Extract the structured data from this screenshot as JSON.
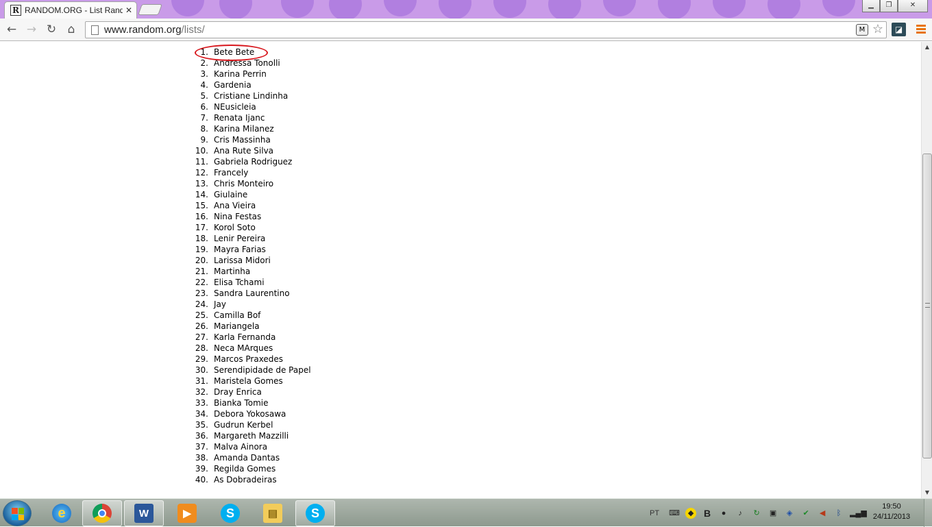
{
  "browser": {
    "tab_title": "RANDOM.ORG - List Rand",
    "tab_favicon_letter": "R",
    "url_host": "www.random.org",
    "url_path": "/lists/"
  },
  "list": [
    {
      "n": "1.",
      "name": "Bete Bete"
    },
    {
      "n": "2.",
      "name": "Andressa Tonolli"
    },
    {
      "n": "3.",
      "name": "Karina Perrin"
    },
    {
      "n": "4.",
      "name": "Gardenia"
    },
    {
      "n": "5.",
      "name": "Cristiane Lindinha"
    },
    {
      "n": "6.",
      "name": "NEusicleia"
    },
    {
      "n": "7.",
      "name": "Renata Ijanc"
    },
    {
      "n": "8.",
      "name": "Karina Milanez"
    },
    {
      "n": "9.",
      "name": "Cris Massinha"
    },
    {
      "n": "10.",
      "name": "Ana Rute Silva"
    },
    {
      "n": "11.",
      "name": "Gabriela Rodriguez"
    },
    {
      "n": "12.",
      "name": "Francely"
    },
    {
      "n": "13.",
      "name": "Chris Monteiro"
    },
    {
      "n": "14.",
      "name": "Giulaine"
    },
    {
      "n": "15.",
      "name": "Ana Vieira"
    },
    {
      "n": "16.",
      "name": "Nina Festas"
    },
    {
      "n": "17.",
      "name": "Korol Soto"
    },
    {
      "n": "18.",
      "name": "Lenir Pereira"
    },
    {
      "n": "19.",
      "name": "Mayra Farias"
    },
    {
      "n": "20.",
      "name": "Larissa Midori"
    },
    {
      "n": "21.",
      "name": "Martinha"
    },
    {
      "n": "22.",
      "name": "Elisa Tchami"
    },
    {
      "n": "23.",
      "name": "Sandra Laurentino"
    },
    {
      "n": "24.",
      "name": "Jay"
    },
    {
      "n": "25.",
      "name": "Camilla Bof"
    },
    {
      "n": "26.",
      "name": "Mariangela"
    },
    {
      "n": "27.",
      "name": "Karla Fernanda"
    },
    {
      "n": "28.",
      "name": "Neca MArques"
    },
    {
      "n": "29.",
      "name": "Marcos Praxedes"
    },
    {
      "n": "30.",
      "name": "Serendipidade de Papel"
    },
    {
      "n": "31.",
      "name": "Maristela Gomes"
    },
    {
      "n": "32.",
      "name": "Dray Enrica"
    },
    {
      "n": "33.",
      "name": "Bianka Tomie"
    },
    {
      "n": "34.",
      "name": "Debora Yokosawa"
    },
    {
      "n": "35.",
      "name": "Gudrun Kerbel"
    },
    {
      "n": "36.",
      "name": "Margareth Mazzilli"
    },
    {
      "n": "37.",
      "name": "Malva Ainora"
    },
    {
      "n": "38.",
      "name": "Amanda Dantas"
    },
    {
      "n": "39.",
      "name": "Regilda Gomes"
    },
    {
      "n": "40.",
      "name": "As Dobradeiras"
    }
  ],
  "taskbar": {
    "lang": "PT",
    "time": "19:50",
    "date": "24/11/2013",
    "apps": [
      "internet-explorer-icon",
      "chrome-icon",
      "word-icon",
      "media-player-icon",
      "skype-icon",
      "explorer-folder-icon",
      "skype-icon"
    ]
  },
  "colors": {
    "highlight_ellipse": "#d8171d",
    "chrome_theme": "#c99be8",
    "menu_accent": "#e8730d"
  }
}
